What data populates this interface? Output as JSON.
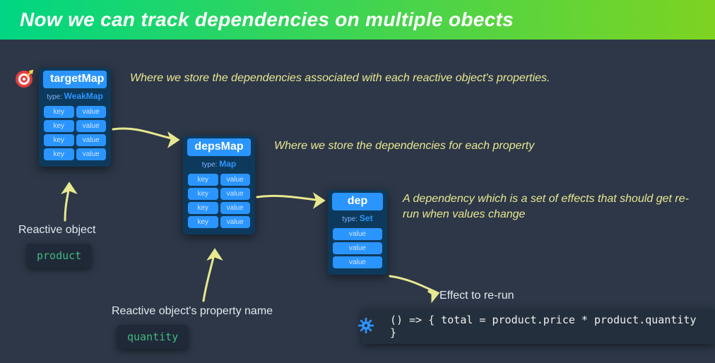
{
  "banner": {
    "title": "Now we can track dependencies on multiple obects"
  },
  "targetMap": {
    "title": "targetMap",
    "type_label": "type:",
    "type": "WeakMap",
    "rows": [
      {
        "k": "key",
        "v": "value"
      },
      {
        "k": "key",
        "v": "value"
      },
      {
        "k": "key",
        "v": "value"
      },
      {
        "k": "key",
        "v": "value"
      }
    ],
    "desc": "Where we store the dependencies associated with each reactive object's properties."
  },
  "depsMap": {
    "title": "depsMap",
    "type_label": "type:",
    "type": "Map",
    "rows": [
      {
        "k": "key",
        "v": "value"
      },
      {
        "k": "key",
        "v": "value"
      },
      {
        "k": "key",
        "v": "value"
      },
      {
        "k": "key",
        "v": "value"
      }
    ],
    "desc": "Where we store the dependencies for each property"
  },
  "dep": {
    "title": "dep",
    "type_label": "type:",
    "type": "Set",
    "rows": [
      {
        "v": "value"
      },
      {
        "v": "value"
      },
      {
        "v": "value"
      }
    ],
    "desc": "A dependency which is a set of effects that should get re-run when values change"
  },
  "labels": {
    "reactive_object": "Reactive object",
    "reactive_prop": "Reactive object's property name",
    "effect": "Effect to re-run"
  },
  "chips": {
    "product": "product",
    "quantity": "quantity"
  },
  "code": {
    "effect_fn": "() => { total = product.price * product.quantity }"
  }
}
